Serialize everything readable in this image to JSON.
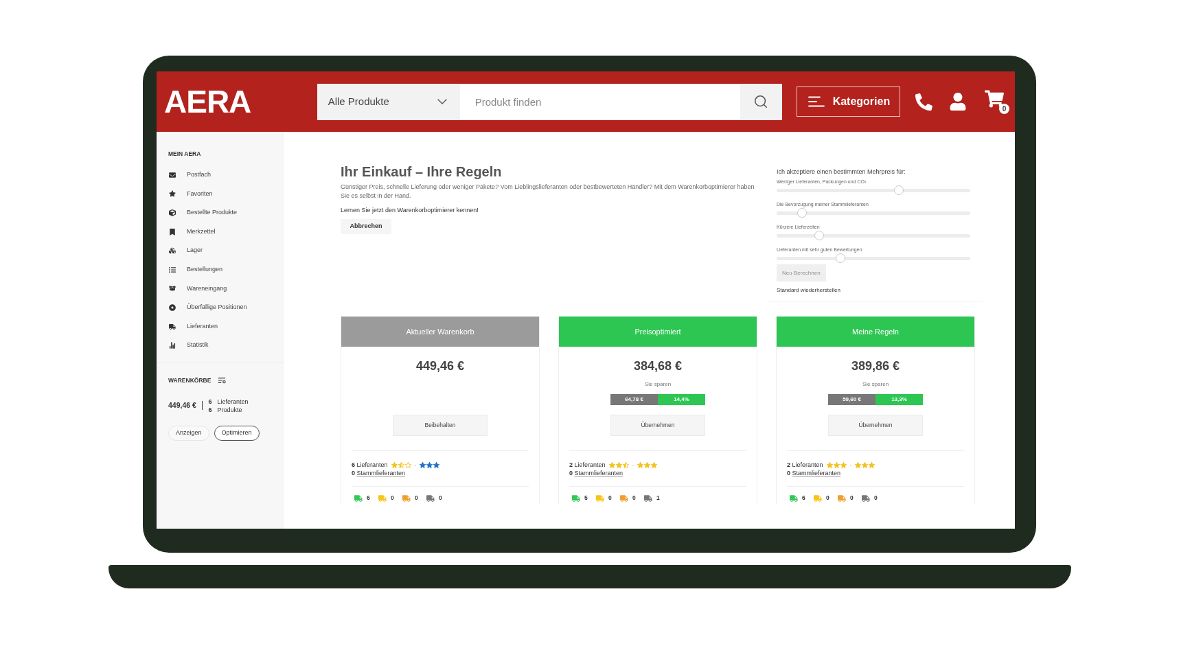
{
  "header": {
    "logo": "AERA",
    "search": {
      "scope": "Alle Produkte",
      "placeholder": "Produkt finden"
    },
    "categories_button": "Kategorien",
    "cart_count": "0"
  },
  "sidebar": {
    "heading": "MEIN AERA",
    "items": [
      "Postfach",
      "Favoriten",
      "Bestellte Produkte",
      "Merkzettel",
      "Lager",
      "Bestellungen",
      "Wareneingang",
      "Überfällige Positionen",
      "Lieferanten",
      "Statistik"
    ],
    "baskets": {
      "heading": "WARENKÖRBE",
      "total": "449,46 €",
      "suppliers": {
        "count": "6",
        "label": "Lieferanten"
      },
      "products": {
        "count": "6",
        "label": "Produkte"
      },
      "buttons": [
        {
          "label": "Anzeigen",
          "kind": "plain"
        },
        {
          "label": "Optimieren",
          "kind": "outline"
        }
      ]
    }
  },
  "intro": {
    "title": "Ihr Einkauf – Ihre Regeln",
    "text": "Günstiger Preis, schnelle Lieferung oder weniger Pakete? Vom Lieblingslieferanten oder bestbewerteten Händler? Mit dem Warenkorboptimierer haben Sie es selbst in der Hand.",
    "prompt": "Lernen Sie jetzt den Warenkorboptimierer kennen!",
    "cancel_button": "Abbrechen"
  },
  "preferences": {
    "heading": "Ich akzeptiere einen bestimmten Mehrpreis für:",
    "sliders": [
      {
        "label": "Weniger Lieferanten, Packungen und CO²",
        "level": 0.63
      },
      {
        "label": "Die Bevorzugung meiner Stammlieferanten",
        "level": 0.13
      },
      {
        "label": "Kürzere Lieferzeiten",
        "level": 0.22
      },
      {
        "label": "Lieferanten mit sehr guten Bewertungen",
        "level": 0.33
      }
    ],
    "recalculate_button": {
      "label": "Neu Berechnen",
      "disabled": true
    },
    "reset_link": "Standard wiederherstellen"
  },
  "baskets": [
    {
      "title": "Aktueller Warenkorb",
      "color": "#9b9b9b",
      "price": "449,46 €",
      "button": "Beibehalten",
      "suppliers": {
        "count": "6",
        "label": "Lieferanten"
      },
      "rating_min": {
        "stars": 1.5,
        "color": "#f2c21b"
      },
      "rating_separator": "-",
      "rating_max": {
        "stars": 3,
        "color": "#1f6fc5"
      },
      "regular_suppliers": {
        "count": "0",
        "label": "Stammlieferanten"
      },
      "deliveries": [
        {
          "color": "#34c759",
          "count": "6"
        },
        {
          "color": "#f5c518",
          "count": "0"
        },
        {
          "color": "#f0a030",
          "count": "0"
        },
        {
          "color": "#777777",
          "count": "0"
        }
      ]
    },
    {
      "title": "Preisoptimiert",
      "color": "#2dc653",
      "price": "384,68 €",
      "savings": {
        "label": "Sie sparen",
        "amount": "64,78 €",
        "percent": "14,4%"
      },
      "button": "Übernehmen",
      "suppliers": {
        "count": "2",
        "label": "Lieferanten"
      },
      "rating_min": {
        "stars": 2.5,
        "color": "#f2c21b"
      },
      "rating_separator": "-",
      "rating_max": {
        "stars": 3,
        "color": "#f2c21b"
      },
      "regular_suppliers": {
        "count": "0",
        "label": "Stammlieferanten"
      },
      "deliveries": [
        {
          "color": "#34c759",
          "count": "5"
        },
        {
          "color": "#f5c518",
          "count": "0"
        },
        {
          "color": "#f0a030",
          "count": "0"
        },
        {
          "color": "#777777",
          "count": "1"
        }
      ]
    },
    {
      "title": "Meine Regeln",
      "color": "#2dc653",
      "price": "389,86 €",
      "savings": {
        "label": "Sie sparen",
        "amount": "59,60 €",
        "percent": "13,3%"
      },
      "button": "Übernehmen",
      "suppliers": {
        "count": "2",
        "label": "Lieferanten"
      },
      "rating_min": {
        "stars": 3,
        "color": "#f2c21b"
      },
      "rating_separator": "-",
      "rating_max": {
        "stars": 3,
        "color": "#f2c21b"
      },
      "regular_suppliers": {
        "count": "0",
        "label": "Stammlieferanten"
      },
      "deliveries": [
        {
          "color": "#34c759",
          "count": "6"
        },
        {
          "color": "#f5c518",
          "count": "0"
        },
        {
          "color": "#f0a030",
          "count": "0"
        },
        {
          "color": "#777777",
          "count": "0"
        }
      ]
    }
  ]
}
